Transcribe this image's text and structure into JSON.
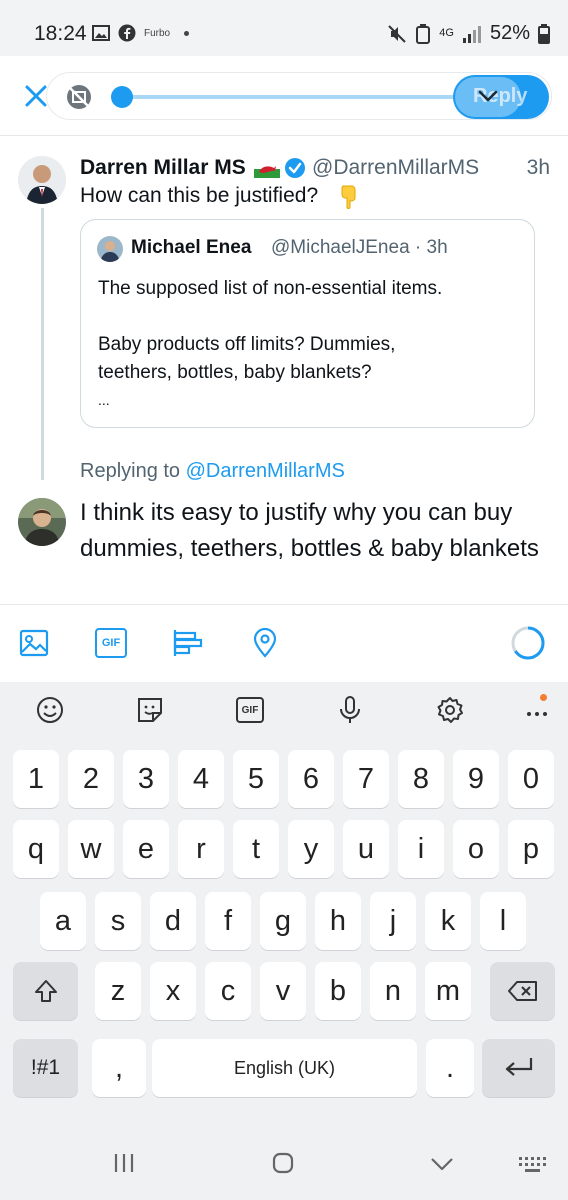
{
  "status_bar": {
    "time": "18:24",
    "app_label": "Furbo",
    "network": "4G",
    "battery": "52%"
  },
  "compose": {
    "reply_label": "Reply"
  },
  "tweet": {
    "author_name": "Darren Millar MS",
    "author_handle": "@DarrenMillarMS",
    "time": "3h",
    "text": "How can this be justified?",
    "quoted": {
      "author_name": "Michael Enea",
      "author_handle": "@MichaelJEnea · 3h",
      "lines": [
        "The supposed list of non-essential items.",
        "",
        "Baby products off limits? Dummies,",
        "teethers, bottles, baby blankets?",
        "..."
      ]
    }
  },
  "reply": {
    "replying_prefix": "Replying to",
    "replying_handle": "@DarrenMillarMS",
    "text": "I think its easy to justify why you can buy dummies, teethers, bottles & baby blankets"
  },
  "toolbar": {
    "gif_label": "GIF"
  },
  "keyboard": {
    "toolbar_gif_label": "GIF",
    "row_numbers": [
      "1",
      "2",
      "3",
      "4",
      "5",
      "6",
      "7",
      "8",
      "9",
      "0"
    ],
    "row1": [
      "q",
      "w",
      "e",
      "r",
      "t",
      "y",
      "u",
      "i",
      "o",
      "p"
    ],
    "row2": [
      "a",
      "s",
      "d",
      "f",
      "g",
      "h",
      "j",
      "k",
      "l"
    ],
    "row3": [
      "z",
      "x",
      "c",
      "v",
      "b",
      "n",
      "m"
    ],
    "symbols_key": "!#1",
    "comma_key": ",",
    "space_label": "English (UK)",
    "period_key": "."
  },
  "colors": {
    "accent": "#1d9bf0",
    "text": "#0f1419",
    "secondary": "#536471",
    "keyboard_bg": "#f0f1f3"
  }
}
